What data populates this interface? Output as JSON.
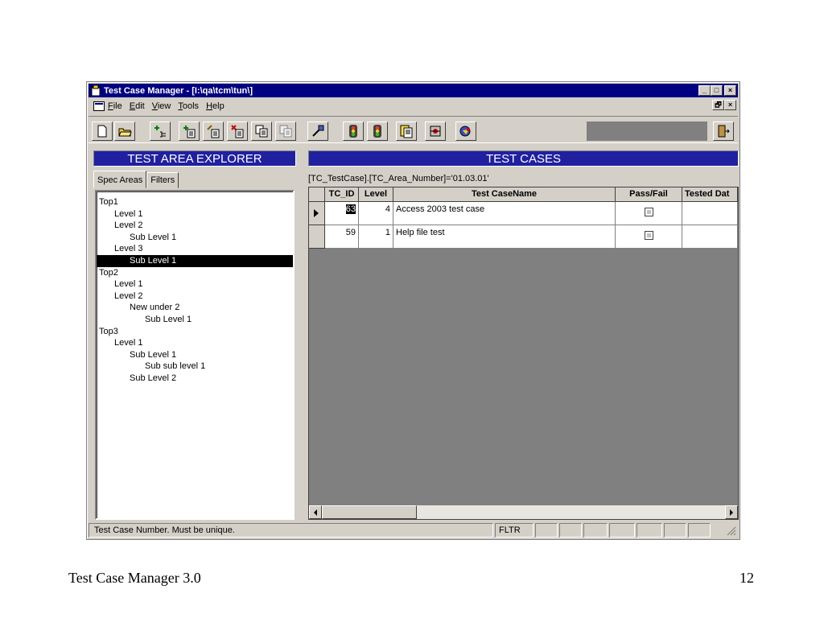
{
  "window": {
    "title": "Test Case Manager - [I:\\qa\\tcm\\tun\\]",
    "caption_buttons": [
      "_",
      "□",
      "×"
    ],
    "mdi_buttons": [
      "🗗",
      "×"
    ]
  },
  "menu": {
    "items": [
      "File",
      "Edit",
      "View",
      "Tools",
      "Help"
    ]
  },
  "toolbar": {
    "buttons": [
      "new",
      "open",
      "add-area-child",
      "add-area",
      "edit-area",
      "delete-area",
      "copy-case",
      "paste-case",
      "link",
      "signal-1",
      "signal-2",
      "report",
      "tools",
      "help",
      "exit"
    ]
  },
  "left_panel": {
    "header": "TEST AREA EXPLORER",
    "tabs": [
      "Spec Areas",
      "Filters"
    ],
    "tree": [
      {
        "label": "Top1",
        "level": 0
      },
      {
        "label": "Level 1",
        "level": 1
      },
      {
        "label": "Level 2",
        "level": 1
      },
      {
        "label": "Sub Level 1",
        "level": 2
      },
      {
        "label": "Level 3",
        "level": 1
      },
      {
        "label": "Sub Level 1",
        "level": 2,
        "selected": true
      },
      {
        "label": "Top2",
        "level": 0
      },
      {
        "label": "Level 1",
        "level": 1
      },
      {
        "label": "Level 2",
        "level": 1
      },
      {
        "label": "New under 2",
        "level": 2
      },
      {
        "label": "Sub Level 1",
        "level": 3
      },
      {
        "label": "Top3",
        "level": 0
      },
      {
        "label": "Level 1",
        "level": 1
      },
      {
        "label": "Sub Level 1",
        "level": 2
      },
      {
        "label": "Sub sub level 1",
        "level": 3
      },
      {
        "label": "Sub Level 2",
        "level": 2
      }
    ]
  },
  "right_panel": {
    "header": "TEST CASES",
    "filter": "[TC_TestCase].[TC_Area_Number]='01.03.01'",
    "columns": [
      "TC_ID",
      "Level",
      "Test CaseName",
      "Pass/Fail",
      "Tested Dat"
    ],
    "rows": [
      {
        "id": "63",
        "level": "4",
        "name": "Access 2003 test case",
        "current": true
      },
      {
        "id": "59",
        "level": "1",
        "name": "Help file test",
        "current": false
      }
    ]
  },
  "statusbar": {
    "message": "Test Case Number.  Must be unique.",
    "flag": "FLTR"
  },
  "slide": {
    "caption": "Test Case Manager 3.0",
    "page": "12"
  }
}
